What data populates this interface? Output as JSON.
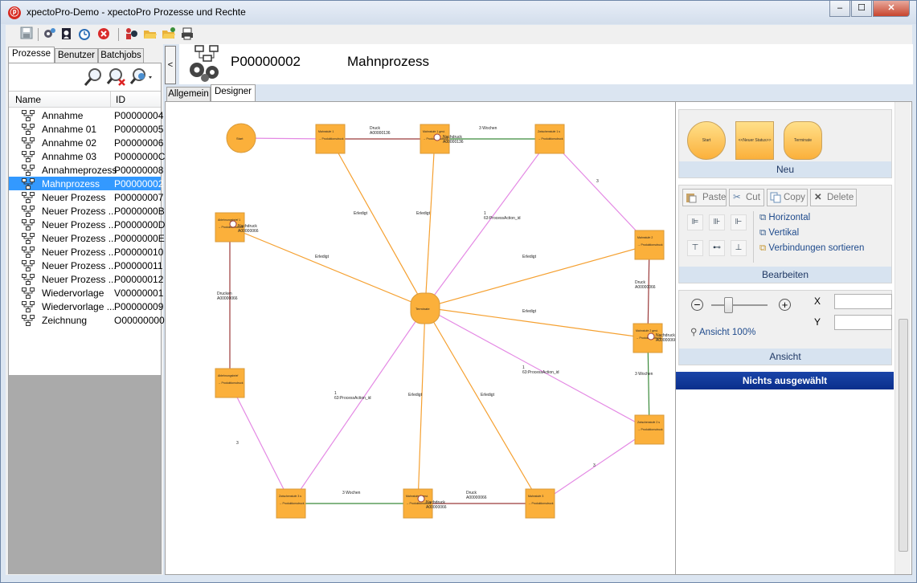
{
  "window": {
    "title": "xpectoPro-Demo - xpectoPro Prozesse und Rechte",
    "app_icon_glyph": "ⓟ",
    "controls": [
      "–",
      "☐",
      "✕"
    ]
  },
  "toolbar": {
    "icons": [
      "save-icon",
      "settings-icon",
      "user-rights-icon",
      "schedule-icon",
      "cancel-icon",
      "info-icon",
      "open-folder-icon",
      "open-folder-alt-icon",
      "print-icon"
    ]
  },
  "left_tabs": [
    "Prozesse",
    "Benutzer",
    "Batchjobs"
  ],
  "list": {
    "headers": {
      "name": "Name",
      "id": "ID"
    },
    "rows": [
      {
        "name": "Annahme",
        "id": "P00000004"
      },
      {
        "name": "Annahme 01",
        "id": "P00000005"
      },
      {
        "name": "Annahme 02",
        "id": "P00000006"
      },
      {
        "name": "Annahme 03",
        "id": "P0000000C"
      },
      {
        "name": "Annahmeprozess",
        "id": "P00000008"
      },
      {
        "name": "Mahnprozess",
        "id": "P00000002",
        "selected": true
      },
      {
        "name": "Neuer Prozess",
        "id": "P00000007"
      },
      {
        "name": "Neuer Prozess ...",
        "id": "P0000000B"
      },
      {
        "name": "Neuer Prozess ...",
        "id": "P0000000D"
      },
      {
        "name": "Neuer Prozess ...",
        "id": "P0000000E"
      },
      {
        "name": "Neuer Prozess ...",
        "id": "P00000010"
      },
      {
        "name": "Neuer Prozess ...",
        "id": "P00000011"
      },
      {
        "name": "Neuer Prozess ...",
        "id": "P00000012"
      },
      {
        "name": "Wiedervorlage",
        "id": "V00000001"
      },
      {
        "name": "Wiedervorlage ...",
        "id": "P00000009"
      },
      {
        "name": "Zeichnung",
        "id": "O00000000"
      }
    ]
  },
  "header": {
    "process_id": "P00000002",
    "process_name": "Mahnprozess",
    "collapse_glyph": "<"
  },
  "designer_tabs": [
    "Allgemein",
    "Designer"
  ],
  "diagram": {
    "nodes": {
      "start": "Start",
      "terminate": "Terminate",
      "m1": "Mahnstufe 1",
      "m1g": "Mahnstufe 1 gest.",
      "z1": "Zwischenstufe 1 s",
      "m2": "Mahnstufe 2",
      "m2g": "Mahnstufe 2 gest.",
      "z2": "Zwischenstufe 2 s",
      "m3": "Mahnstufe 3",
      "m3g": "Mahnstufe 3 gest.",
      "z3": "Zwischenstufe 3 s",
      "abl1": "Ablehnungsbrief 1",
      "abl": "Ablehnungsbrief"
    },
    "node_sub": "→ Produktionsdruck",
    "labels": {
      "druck": "Druck",
      "druck_nr": "A00000136",
      "druck_nr2": "A00000066",
      "nachdruck": "Nachdruck",
      "wochen": "3 Wochen",
      "erledigt": "Erledigt",
      "drucken": "Drucken",
      "action": "63:ProcessAction_id",
      "one": "1",
      "three": "3"
    }
  },
  "neu": {
    "title": "Neu",
    "items": [
      "Start",
      "<<Neuer Status>>",
      "Terminate"
    ]
  },
  "bearbeiten": {
    "title": "Bearbeiten",
    "buttons": {
      "paste": "Paste",
      "cut": "Cut",
      "copy": "Copy",
      "delete": "Delete"
    },
    "links": {
      "horizontal": "Horizontal",
      "vertikal": "Vertikal",
      "sort": "Verbindungen sortieren"
    }
  },
  "ansicht": {
    "title": "Ansicht",
    "zoom_label": "Ansicht 100%",
    "x_label": "X",
    "y_label": "Y",
    "zoom_level": 0.3
  },
  "status_bar": {
    "text": "Nichts ausgewählt"
  },
  "colors": {
    "accent": "#3399ff",
    "node_fill": "#fbb03b",
    "edge_orange": "#f5a030",
    "edge_pink": "#e489e4",
    "edge_green": "#3a8a3a",
    "edge_red": "#9b3a3a"
  }
}
